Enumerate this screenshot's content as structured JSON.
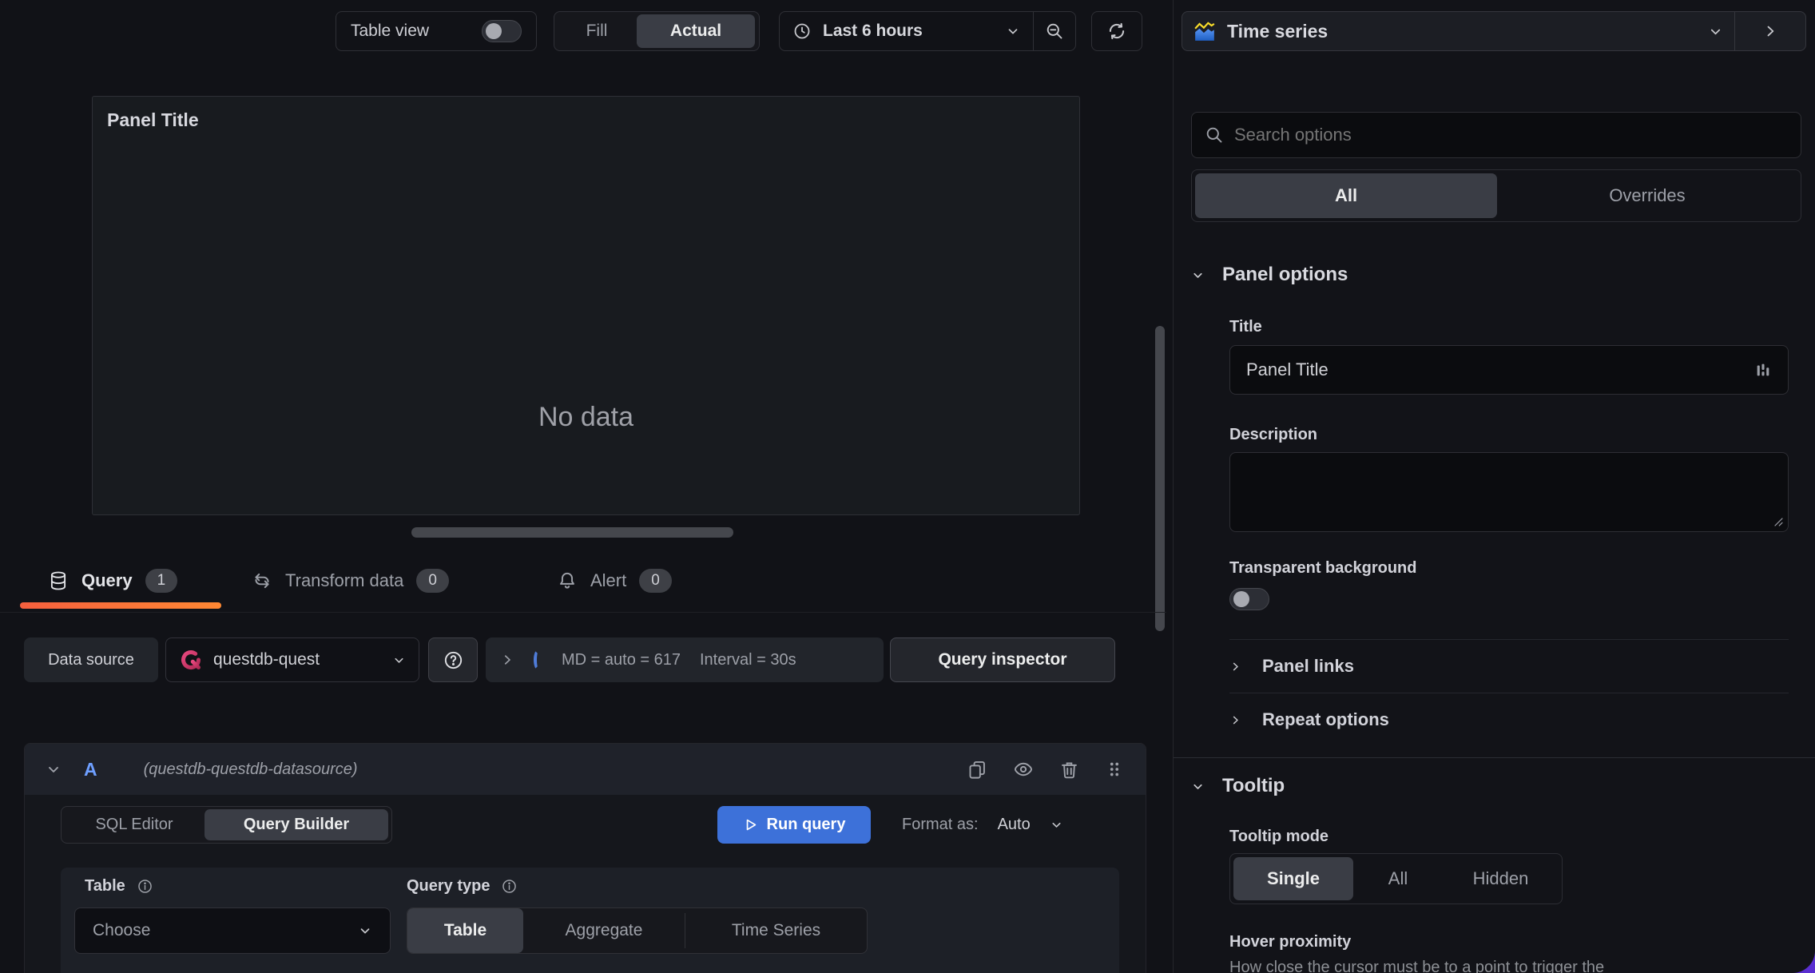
{
  "toolbar": {
    "table_view": "Table view",
    "fill": "Fill",
    "actual": "Actual",
    "time_range": "Last 6 hours"
  },
  "panel": {
    "title": "Panel Title",
    "no_data": "No data"
  },
  "tabs": [
    {
      "label": "Query",
      "count": "1"
    },
    {
      "label": "Transform data",
      "count": "0"
    },
    {
      "label": "Alert",
      "count": "0"
    }
  ],
  "query_toolbar": {
    "data_source_label": "Data source",
    "data_source_value": "questdb-quest",
    "md_stat": "MD = auto = 617",
    "interval_stat": "Interval = 30s",
    "query_inspector": "Query inspector"
  },
  "query_row": {
    "ref_id": "A",
    "datasource_hint": "(questdb-questdb-datasource)",
    "modes": [
      "SQL Editor",
      "Query Builder"
    ],
    "run_query": "Run query",
    "format_as_label": "Format as:",
    "format_as_value": "Auto",
    "table_label": "Table",
    "table_value": "Choose",
    "query_type_label": "Query type",
    "query_type_options": [
      "Table",
      "Aggregate",
      "Time Series"
    ]
  },
  "options": {
    "viz_name": "Time series",
    "search_placeholder": "Search options",
    "filters": [
      "All",
      "Overrides"
    ],
    "panel_options": {
      "header": "Panel options",
      "title_label": "Title",
      "title_value": "Panel Title",
      "description_label": "Description",
      "transparent_label": "Transparent background",
      "panel_links": "Panel links",
      "repeat_options": "Repeat options"
    },
    "tooltip": {
      "header": "Tooltip",
      "mode_label": "Tooltip mode",
      "modes": [
        "Single",
        "All",
        "Hidden"
      ],
      "hover_label": "Hover proximity",
      "hover_help": "How close the cursor must be to a point to trigger the"
    }
  },
  "colors": {
    "accent_blue": "#3d71d9",
    "tab_gradient_from": "#f55f3e",
    "tab_gradient_to": "#ff8833",
    "questdb_pink": "#d63864",
    "corner_purple": "#5a2fd0"
  }
}
